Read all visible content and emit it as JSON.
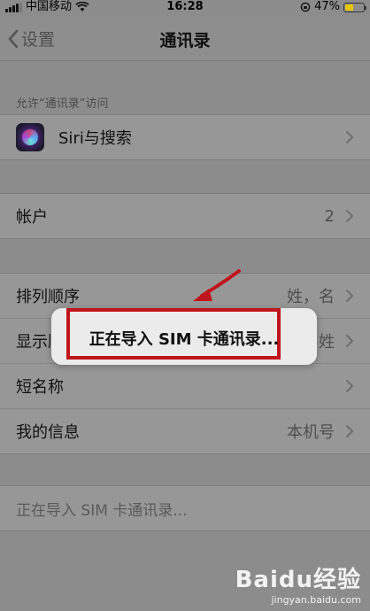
{
  "status_bar": {
    "carrier": "中国移动",
    "time": "16:28",
    "battery_percent": "47%",
    "battery_level": 0.47,
    "icons": [
      "signal-icon",
      "wifi-icon",
      "rotation-lock-icon",
      "battery-icon"
    ]
  },
  "nav": {
    "back_label": "设置",
    "title": "通讯录"
  },
  "section_header": "允许“通讯录”访问",
  "siri_row": {
    "label": "Siri与搜索",
    "icon": "siri-icon"
  },
  "account_row": {
    "label": "帐户",
    "value": "2"
  },
  "settings_rows": [
    {
      "label": "排列顺序",
      "value": "姓，名"
    },
    {
      "label": "显示顺序",
      "value": "姓"
    },
    {
      "label": "短名称",
      "value": ""
    },
    {
      "label": "我的信息",
      "value": "本机号"
    }
  ],
  "import_row": {
    "label": "正在导入 SIM 卡通讯录..."
  },
  "popup": {
    "text": "正在导入 SIM 卡通讯录..."
  },
  "annotation": {
    "outline_color": "#c0141c",
    "arrow_color": "#c0141c"
  },
  "watermark": {
    "logo": "Baidu经验",
    "site": "jingyan.baidu.com"
  }
}
